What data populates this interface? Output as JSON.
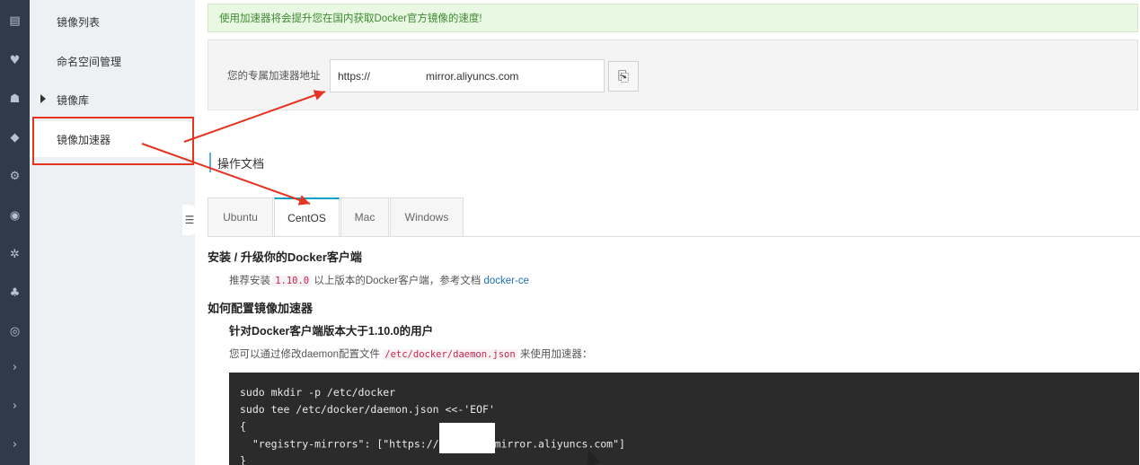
{
  "rail": {
    "icons": [
      "list-icon",
      "shield-icon",
      "network-icon",
      "cube-icon",
      "gear-icon",
      "eye-icon",
      "star-icon",
      "tree-icon",
      "settings-icon",
      "chevron-right-icon",
      "chevron-right-icon",
      "chevron-right-icon"
    ],
    "glyphs": [
      "▤",
      "♥",
      "☗",
      "◆",
      "⚙",
      "◉",
      "✲",
      "♣",
      "◎",
      "›",
      "›",
      "›"
    ]
  },
  "sidebar": {
    "items": [
      {
        "label": "镜像列表"
      },
      {
        "label": "命名空间管理"
      },
      {
        "label": "镜像库"
      },
      {
        "label": "镜像加速器"
      }
    ],
    "handle_glyph": "☰"
  },
  "notice": {
    "text": "使用加速器将会提升您在国内获取Docker官方镜像的速度!"
  },
  "accelerator": {
    "label": "您的专属加速器地址",
    "url_prefix": "https://",
    "url_suffix": "mirror.aliyuncs.com",
    "copy_glyph": "⎘"
  },
  "docs": {
    "title": "操作文档",
    "tabs": [
      "Ubuntu",
      "CentOS",
      "Mac",
      "Windows"
    ],
    "active_tab": "CentOS",
    "section1_title": "安装 / 升级你的Docker客户端",
    "section1_text_a": "推荐安装 ",
    "section1_version": "1.10.0",
    "section1_text_b": " 以上版本的Docker客户端，参考文档 ",
    "section1_link": "docker-ce",
    "section2_title": "如何配置镜像加速器",
    "section2_sub": "针对Docker客户端版本大于1.10.0的用户",
    "section2_text_a": "您可以通过修改daemon配置文件 ",
    "section2_path": "/etc/docker/daemon.json",
    "section2_text_b": " 来使用加速器：",
    "code": {
      "line1": "sudo mkdir -p /etc/docker",
      "line2": "sudo tee /etc/docker/daemon.json <<-'EOF'",
      "line3": "{",
      "line4_a": "  \"registry-mirrors\": [\"https://",
      "line4_b": "mirror.aliyuncs.com\"]",
      "line5": "}"
    }
  },
  "colors": {
    "annotation": "#e53422",
    "tab_accent": "#00a2ca",
    "rail_bg": "#2f3b4a"
  }
}
